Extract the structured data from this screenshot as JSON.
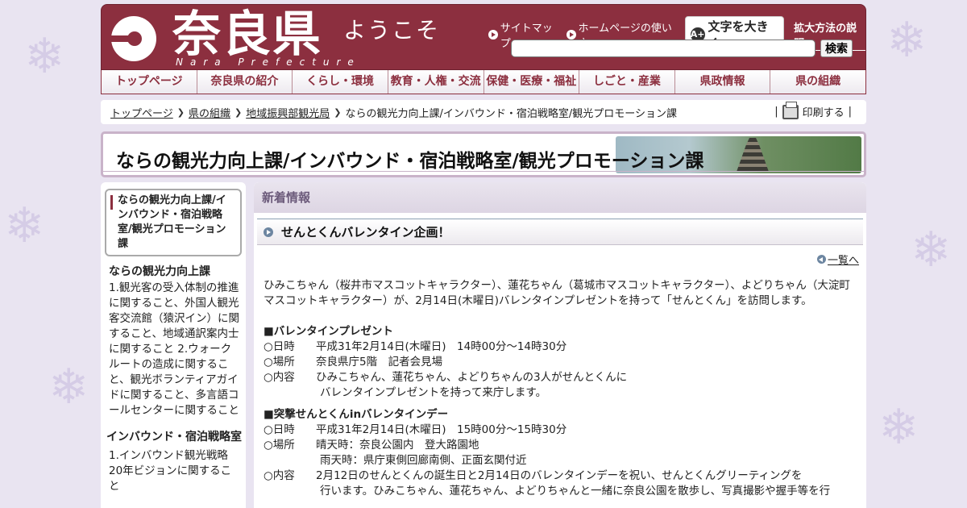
{
  "header": {
    "logo_title": "奈良県",
    "logo_sub": "Nara Prefecture",
    "welcome": "ようこそ",
    "links": [
      "サイトマップ",
      "ホームページの使い方"
    ],
    "bigtext_label": "文字を大きく",
    "bigtext_icon": "A+",
    "howto_label": "拡大方法の説明",
    "search_value": "",
    "search_button": "検索"
  },
  "nav": [
    "トップページ",
    "奈良県の紹介",
    "くらし・環境",
    "教育・人権・交流",
    "保健・医療・福祉",
    "しごと・産業",
    "県政情報",
    "県の組織"
  ],
  "breadcrumb": {
    "links": [
      "トップページ",
      "県の組織",
      "地域振興部観光局"
    ],
    "current": "ならの観光力向上課/インバウンド・宿泊戦略室/観光プロモーション課",
    "print_label": "印刷する"
  },
  "page_title": "ならの観光力向上課/インバウンド・宿泊戦略室/観光プロモーション課",
  "sidebar": {
    "current": "ならの観光力向上課/インバウンド・宿泊戦略室/観光プロモーション課",
    "sec1_title": "ならの観光力向上課",
    "sec1_text": "1.観光客の受入体制の推進に関すること、外国人観光客交流館（猿沢イン）に関すること、地域通訳案内士に関すること 2.ウォークルートの造成に関すること、観光ボランティアガイドに関すること、多言語コールセンターに関すること",
    "sec2_title": "インバウンド・宿泊戦略室",
    "sec2_text": "1.インバウンド観光戦略20年ビジョンに関すること"
  },
  "main": {
    "news_head": "新着情報",
    "article_title": "せんとくんバレンタイン企画！",
    "list_link": "一覧へ",
    "intro": "ひみこちゃん（桜井市マスコットキャラクター）、蓮花ちゃん（葛城市マスコットキャラクター）、よどりちゃん（大淀町マスコットキャラクター）が、2月14日(木曜日)バレンタインプレゼントを持って「せんとくん」を訪問します。",
    "sec1": {
      "title": "■バレンタインプレゼント",
      "date_k": "○日時",
      "date_v": "平成31年2月14日(木曜日)　14時00分～14時30分",
      "place_k": "○場所",
      "place_v": "奈良県庁5階　記者会見場",
      "desc_k": "○内容",
      "desc_v": "ひみこちゃん、蓮花ちゃん、よどりちゃんの3人がせんとくんに",
      "desc_v2": "バレンタインプレゼントを持って来庁します。"
    },
    "sec2": {
      "title": "■突撃せんとくんinバレンタインデー",
      "date_k": "○日時",
      "date_v": "平成31年2月14日(木曜日)　15時00分～15時30分",
      "place_k": "○場所",
      "place_v": "晴天時：奈良公園内　登大路園地",
      "place_v2": "雨天時：県庁東側回廊南側、正面玄関付近",
      "desc_k": "○内容",
      "desc_v": "2月12日のせんとくんの誕生日と2月14日のバレンタインデーを祝い、せんとくんグリーティングを",
      "desc_v2": "行います。ひみこちゃん、蓮花ちゃん、よどりちゃんと一緒に奈良公園を散歩し、写真撮影や握手等を行"
    }
  },
  "colors": {
    "brand": "#8c2f3f",
    "background": "#e9e4f1",
    "news_head": "#6b5a7a"
  }
}
